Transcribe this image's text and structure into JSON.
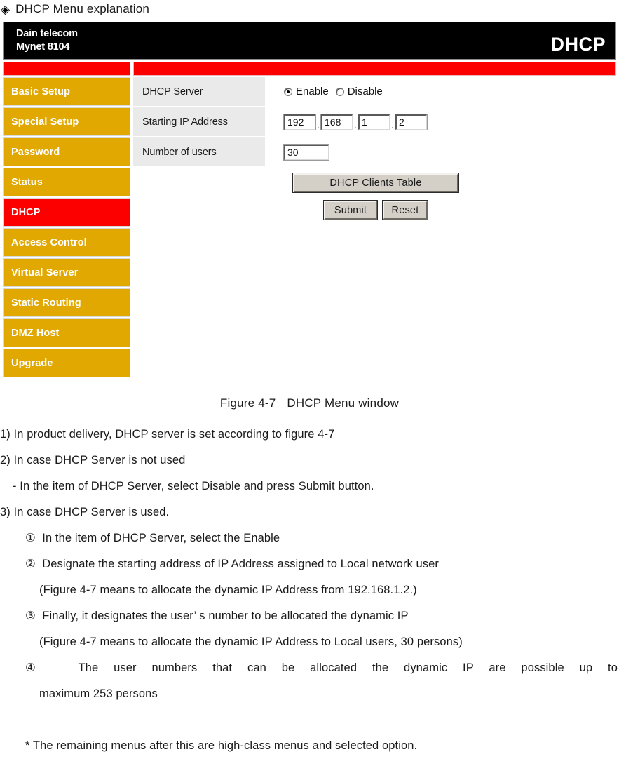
{
  "doc": {
    "heading_bullet": "diamond-bullet-icon",
    "heading": "DHCP Menu explanation",
    "figure_caption_left": "Figure 4-7",
    "figure_caption_right": "DHCP Menu window"
  },
  "router_ui": {
    "brand": "Dain telecom",
    "model": "Mynet 8104",
    "page_title": "DHCP",
    "colors": {
      "header_bg": "#000000",
      "accent_red": "#FC0000",
      "nav_bg": "#E0A800",
      "nav_active_bg": "#FC0000",
      "label_cell_bg": "#EAEAEA",
      "button_face": "#D4D0C8"
    },
    "sidebar": {
      "items": [
        {
          "label": "Basic Setup",
          "active": false
        },
        {
          "label": "Special Setup",
          "active": false
        },
        {
          "label": "Password",
          "active": false
        },
        {
          "label": "Status",
          "active": false
        },
        {
          "label": "DHCP",
          "active": true
        },
        {
          "label": "Access Control",
          "active": false
        },
        {
          "label": "Virtual Server",
          "active": false
        },
        {
          "label": "Static Routing",
          "active": false
        },
        {
          "label": "DMZ Host",
          "active": false
        },
        {
          "label": "Upgrade",
          "active": false
        }
      ]
    },
    "form": {
      "rows": [
        {
          "label": "DHCP Server"
        },
        {
          "label": "Starting IP Address"
        },
        {
          "label": "Number of users"
        }
      ],
      "dhcp_server": {
        "enable_label": "Enable",
        "disable_label": "Disable",
        "selected": "Enable"
      },
      "starting_ip": {
        "octet1": "192",
        "octet2": "168",
        "octet3": "1",
        "octet4": "2",
        "separator": "."
      },
      "number_of_users": "30"
    },
    "buttons": {
      "clients_table": "DHCP Clients Table",
      "submit": "Submit",
      "reset": "Reset"
    }
  },
  "notes": {
    "line1": "1) In product delivery, DHCP server is set according to figure 4-7",
    "line2": "2) In case DHCP Server is not used",
    "line3": "- In the item of DHCP Server, select Disable and press Submit button.",
    "line4": "3) In case DHCP Server is used.",
    "line5": "①  In the item of DHCP Server, select the Enable",
    "line6": "②  Designate the starting address of IP Address assigned to Local network user",
    "line7": "(Figure 4-7 means to allocate the dynamic IP Address from 192.168.1.2.)",
    "line8": "③  Finally, it designates the user’ s number to be allocated the dynamic IP",
    "line9": "(Figure 4-7 means to allocate the dynamic IP Address to Local users, 30 persons)",
    "line10": "④  The user numbers that can be allocated the dynamic IP are possible up to",
    "line11": "maximum 253 persons",
    "line12": "* The remaining menus after this are high-class menus and selected option."
  }
}
